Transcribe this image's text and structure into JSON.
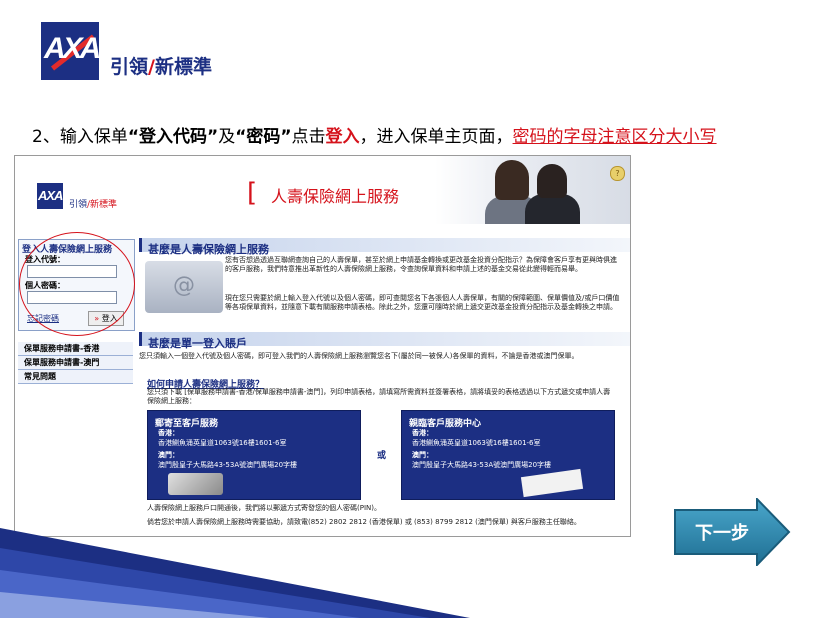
{
  "slide": {
    "logo_text": "AXA",
    "tagline_a": "引領",
    "tagline_slash": "/",
    "tagline_b": "新標準",
    "instruction": {
      "p1": "2、输入保单",
      "p2": "“登入代码”",
      "p3": "及",
      "p4": "“密码”",
      "p5": "点击",
      "p6": "登入",
      "p7": "，进入保单主页面，",
      "p8": "密码的字母注意区分大小写"
    },
    "next_label": "下一步"
  },
  "screenshot": {
    "logo_text": "AXA",
    "tagline_a": "引領",
    "tagline_b": "/新標準",
    "page_title": "人壽保險網上服務",
    "coin_icon_label": "?",
    "login": {
      "legend": "登入人壽保險網上服務",
      "code_label": "登入代號：",
      "password_label": "個人密碼：",
      "forgot_link": "忘記密碼",
      "login_button": "登入"
    },
    "nav": [
      "保單服務申請書-香港",
      "保單服務申請書-澳門",
      "常見問題"
    ],
    "section1": {
      "title": "甚麼是人壽保險網上服務",
      "para1": "您有否想過透過互聯網查詢自己的人壽保單，甚至於網上申請基金轉換或更改基金投資分配指示？為保障會客戶享有更與時俱進的客戶服務，我們特意推出革新性的人壽保險網上服務，令查詢保單資料和申請上述的基金交易從此變得輕而易舉。",
      "para2": "現在您只需要於網上輸入登入代號以及個人密碼，即可查閱您名下各張個人人壽保單，有關的保障範圍、保單價值及/或戶口價值等各項保單資料，並隨意下載有關服務申請表格。除此之外，您還可隨時於網上遞交更改基金投資分配指示及基金轉換之申請。"
    },
    "section2": {
      "title": "甚麼是單一登入賬戶",
      "para1": "您只須輸入一個登入代號及個人密碼，即可登入我們的人壽保險網上服務瀏覽您名下(屬於同一被保人)各保單的資料，不論是香港或澳門保單。",
      "howto_title": "如何申請人壽保險網上服務？",
      "howto_text": "您只須下載 [保單服務申請書-香港/保單服務申請書-澳門]，列印申請表格，請填寫所需資料並簽署表格，請將填妥的表格透過以下方式遞交或申請人壽保險網上服務："
    },
    "panel_mail": {
      "title": "郵寄至客戶服務",
      "hk_label": "香港：",
      "hk_addr": "香港鰂魚涌英皇道1063號16樓1601-6室",
      "mo_label": "澳門：",
      "mo_addr": "澳門殷皇子大馬路43-53A號澳門廣場20字樓"
    },
    "or_text": "或",
    "panel_visit": {
      "title": "親臨客戶服務中心",
      "hk_label": "香港：",
      "hk_addr": "香港鰂魚涌英皇道1063號16樓1601-6室",
      "mo_label": "澳門：",
      "mo_addr": "澳門殷皇子大馬路43-53A號澳門廣場20字樓"
    },
    "footer1": "人壽保險網上服務戶口開通後，我們將以郵遞方式寄發您的個人密碼(PIN)。",
    "footer2": "倘若您於申請人壽保險網上服務時需要協助，請致電(852) 2802 2812 (香港保單) 或 (853) 8799 2812 (澳門保單) 與客戶服務主任聯絡。"
  },
  "colors": {
    "brand_blue": "#1c2f83",
    "brand_red": "#d5121b",
    "next_button": "#2b84a8"
  }
}
